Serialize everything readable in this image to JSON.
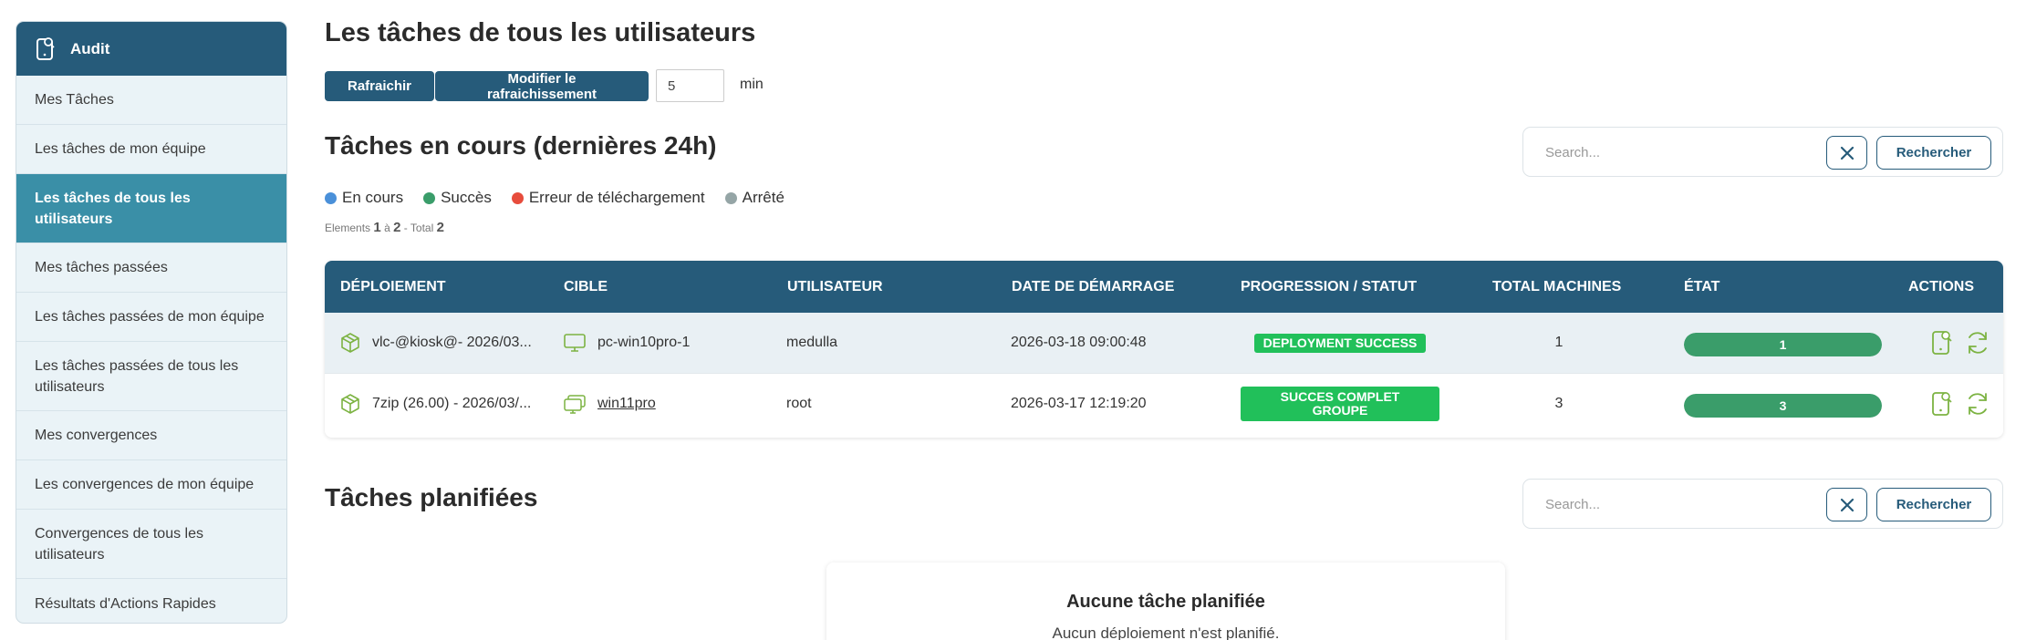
{
  "sidebar": {
    "header": "Audit",
    "items": [
      {
        "label": "Mes Tâches"
      },
      {
        "label": "Les tâches de mon équipe"
      },
      {
        "label": "Les tâches de tous les utilisateurs"
      },
      {
        "label": "Mes tâches passées"
      },
      {
        "label": "Les tâches passées de mon équipe"
      },
      {
        "label": "Les tâches passées de tous les utilisateurs"
      },
      {
        "label": "Mes convergences"
      },
      {
        "label": "Les convergences de mon équipe"
      },
      {
        "label": "Convergences de tous les utilisateurs"
      },
      {
        "label": "Résultats d'Actions Rapides"
      }
    ],
    "active_index": 2
  },
  "header": {
    "title": "Les tâches de tous les utilisateurs",
    "refresh_label": "Rafraichir",
    "modify_refresh_label": "Modifier le rafraichissement",
    "refresh_value": "5",
    "refresh_unit": "min"
  },
  "current": {
    "title": "Tâches en cours (dernières 24h)",
    "search": {
      "placeholder": "Search...",
      "button": "Rechercher"
    },
    "legend": [
      {
        "label": "En cours",
        "color": "#4a90d9"
      },
      {
        "label": "Succès",
        "color": "#3a9d6a"
      },
      {
        "label": "Erreur de téléchargement",
        "color": "#e74c3c"
      },
      {
        "label": "Arrêté",
        "color": "#95a5a6"
      }
    ],
    "count": {
      "prefix": "Elements",
      "from": "1",
      "sep": "à",
      "to": "2",
      "total_prefix": "- Total",
      "total": "2"
    },
    "columns": [
      "DÉPLOIEMENT",
      "CIBLE",
      "UTILISATEUR",
      "DATE DE DÉMARRAGE",
      "PROGRESSION / STATUT",
      "TOTAL MACHINES",
      "ÉTAT",
      "ACTIONS"
    ],
    "rows": [
      {
        "deployment": "vlc-@kiosk@- 2026/03...",
        "target": "pc-win10pro-1",
        "target_icon": "monitor-icon",
        "user": "medulla",
        "start": "2026-03-18 09:00:48",
        "status": "DEPLOYMENT SUCCESS",
        "machines": "1",
        "state": "1",
        "state_fraction": 1.0
      },
      {
        "deployment": "7zip (26.00) - 2026/03/...",
        "target": "win11pro",
        "target_icon": "monitors-group-icon",
        "user": "root",
        "start": "2026-03-17 12:19:20",
        "status": "SUCCES COMPLET GROUPE",
        "machines": "3",
        "state": "3",
        "state_fraction": 1.0
      }
    ]
  },
  "planned": {
    "title": "Tâches planifiées",
    "search": {
      "placeholder": "Search...",
      "button": "Rechercher"
    },
    "empty_title": "Aucune tâche planifiée",
    "empty_sub": "Aucun déploiement n'est planifié."
  },
  "colors": {
    "primary": "#265b7a",
    "active": "#3a8fa7",
    "success": "#21c05a",
    "state": "#3a9d6a",
    "icon": "#7cb342"
  }
}
